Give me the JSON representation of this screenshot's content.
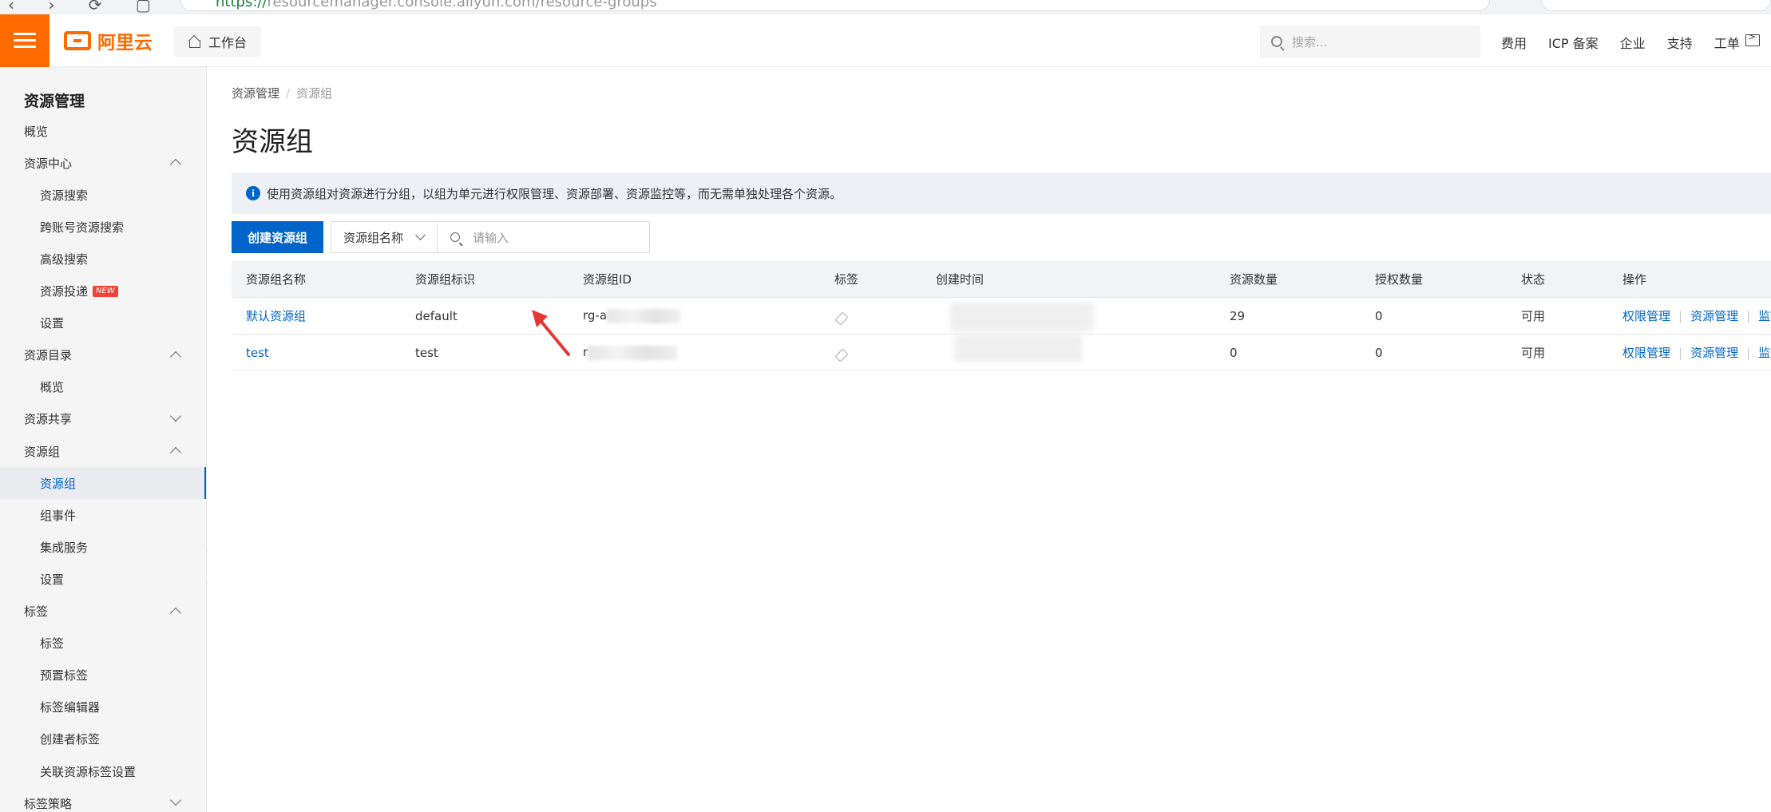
{
  "browser": {
    "url_scheme": "https://",
    "url_rest": "resourcemanager.console.aliyun.com/resource-groups"
  },
  "topbar": {
    "logo_text": "阿里云",
    "workbench": "工作台",
    "search_placeholder": "搜索...",
    "links": [
      "费用",
      "ICP 备案",
      "企业",
      "支持",
      "工单"
    ]
  },
  "sidebar": {
    "title": "资源管理",
    "items": [
      {
        "label": "概览",
        "level": "group"
      },
      {
        "label": "资源中心",
        "level": "group",
        "chevron": "up"
      },
      {
        "label": "资源搜索",
        "level": "sub"
      },
      {
        "label": "跨账号资源搜索",
        "level": "sub"
      },
      {
        "label": "高级搜索",
        "level": "sub"
      },
      {
        "label": "资源投递",
        "level": "sub",
        "badge": "NEW"
      },
      {
        "label": "设置",
        "level": "sub"
      },
      {
        "label": "资源目录",
        "level": "group",
        "chevron": "up"
      },
      {
        "label": "概览",
        "level": "sub"
      },
      {
        "label": "资源共享",
        "level": "group",
        "chevron": "down"
      },
      {
        "label": "资源组",
        "level": "group",
        "chevron": "up"
      },
      {
        "label": "资源组",
        "level": "sub",
        "active": true
      },
      {
        "label": "组事件",
        "level": "sub"
      },
      {
        "label": "集成服务",
        "level": "sub"
      },
      {
        "label": "设置",
        "level": "sub"
      },
      {
        "label": "标签",
        "level": "group",
        "chevron": "up"
      },
      {
        "label": "标签",
        "level": "sub"
      },
      {
        "label": "预置标签",
        "level": "sub"
      },
      {
        "label": "标签编辑器",
        "level": "sub"
      },
      {
        "label": "创建者标签",
        "level": "sub"
      },
      {
        "label": "关联资源标签设置",
        "level": "sub"
      },
      {
        "label": "标签策略",
        "level": "group",
        "chevron": "down"
      }
    ]
  },
  "main": {
    "breadcrumb": [
      "资源管理",
      "资源组"
    ],
    "title": "资源组",
    "info": "使用资源组对资源进行分组，以组为单元进行权限管理、资源部署、资源监控等，而无需单独处理各个资源。",
    "create_button": "创建资源组",
    "filter_select": "资源组名称",
    "filter_placeholder": "请输入",
    "table": {
      "headers": [
        "资源组名称",
        "资源组标识",
        "资源组ID",
        "标签",
        "创建时间",
        "资源数量",
        "授权数量",
        "状态",
        "操作"
      ],
      "rows": [
        {
          "name": "默认资源组",
          "identifier": "default",
          "id_prefix": "rg-a",
          "resources": "29",
          "auths": "0",
          "status": "可用",
          "ops": [
            "权限管理",
            "资源管理",
            "监控"
          ]
        },
        {
          "name": "test",
          "identifier": "test",
          "id_prefix": "r",
          "resources": "0",
          "auths": "0",
          "status": "可用",
          "ops": [
            "权限管理",
            "资源管理",
            "监控"
          ]
        }
      ]
    }
  },
  "colors": {
    "brand_orange": "#ff6a00",
    "primary_blue": "#0064c8",
    "annotation_red": "#e53935"
  }
}
